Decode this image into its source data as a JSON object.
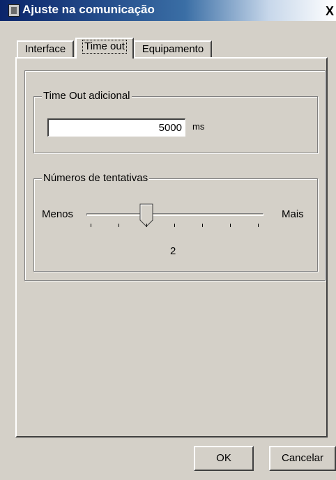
{
  "window": {
    "title": "Ajuste na comunicação",
    "close_label": "X"
  },
  "tabs": [
    {
      "label": "Interface",
      "active": false
    },
    {
      "label": "Time out",
      "active": true
    },
    {
      "label": "Equipamento",
      "active": false
    }
  ],
  "timeout_group": {
    "legend": "Time Out adicional",
    "value": "5000",
    "unit": "ms"
  },
  "retries_group": {
    "legend": "Números de tentativas",
    "min_label": "Menos",
    "max_label": "Mais",
    "value": "2",
    "tick_count": 7,
    "position": 2
  },
  "buttons": {
    "ok": "OK",
    "cancel": "Cancelar"
  }
}
